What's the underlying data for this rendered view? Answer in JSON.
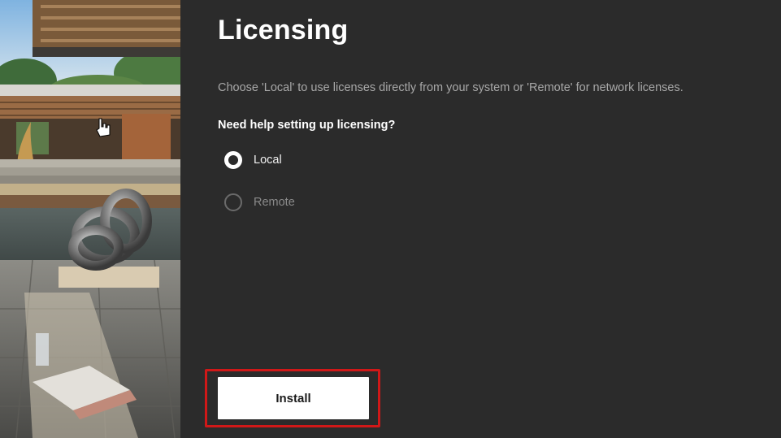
{
  "page": {
    "title": "Licensing",
    "description": "Choose 'Local' to use licenses directly from your system or 'Remote' for network licenses.",
    "help_heading": "Need help setting up licensing?"
  },
  "license_options": [
    {
      "label": "Local",
      "selected": true
    },
    {
      "label": "Remote",
      "selected": false
    }
  ],
  "actions": {
    "install_label": "Install"
  },
  "colors": {
    "background": "#2b2b2b",
    "highlight": "#d01818",
    "button": "#ffffff"
  }
}
